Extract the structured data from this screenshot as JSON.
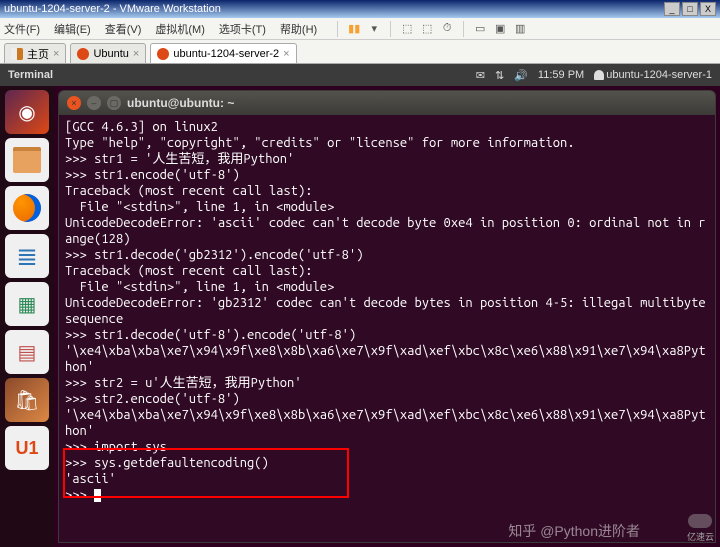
{
  "outer": {
    "title": "ubuntu-1204-server-2 - VMware Workstation",
    "btn_min": "_",
    "btn_max": "□",
    "btn_close": "X"
  },
  "menu": {
    "file": "文件(F)",
    "edit": "编辑(E)",
    "view": "查看(V)",
    "vm": "虚拟机(M)",
    "tabs": "选项卡(T)",
    "help": "帮助(H)"
  },
  "vmtabs": {
    "home": "主页",
    "t1": "Ubuntu",
    "t2": "ubuntu-1204-server-2",
    "close": "×"
  },
  "panel": {
    "app": "Terminal",
    "time": "11:59 PM",
    "user": "ubuntu-1204-server-1"
  },
  "term": {
    "title": "ubuntu@ubuntu: ~",
    "btn_close": "×",
    "btn_min": "–",
    "btn_max": "▢",
    "lines": [
      "[GCC 4.6.3] on linux2",
      "Type \"help\", \"copyright\", \"credits\" or \"license\" for more information.",
      ">>> str1 = '人生苦短，我用Python'",
      ">>> str1.encode('utf-8')",
      "Traceback (most recent call last):",
      "  File \"<stdin>\", line 1, in <module>",
      "UnicodeDecodeError: 'ascii' codec can't decode byte 0xe4 in position 0: ordinal not in range(128)",
      ">>> str1.decode('gb2312').encode('utf-8')",
      "Traceback (most recent call last):",
      "  File \"<stdin>\", line 1, in <module>",
      "UnicodeDecodeError: 'gb2312' codec can't decode bytes in position 4-5: illegal multibyte sequence",
      ">>> str1.decode('utf-8').encode('utf-8')",
      "'\\xe4\\xba\\xba\\xe7\\x94\\x9f\\xe8\\x8b\\xa6\\xe7\\x9f\\xad\\xef\\xbc\\x8c\\xe6\\x88\\x91\\xe7\\x94\\xa8Python'",
      ">>> str2 = u'人生苦短，我用Python'",
      ">>> str2.encode('utf-8')",
      "'\\xe4\\xba\\xba\\xe7\\x94\\x9f\\xe8\\x8b\\xa6\\xe7\\x9f\\xad\\xef\\xbc\\x8c\\xe6\\x88\\x91\\xe7\\x94\\xa8Python'",
      ">>> import sys",
      ">>> sys.getdefaultencoding()",
      "'ascii'",
      ">>> "
    ]
  },
  "watermark1": "知乎 @Python进阶者",
  "watermark2": "亿速云"
}
